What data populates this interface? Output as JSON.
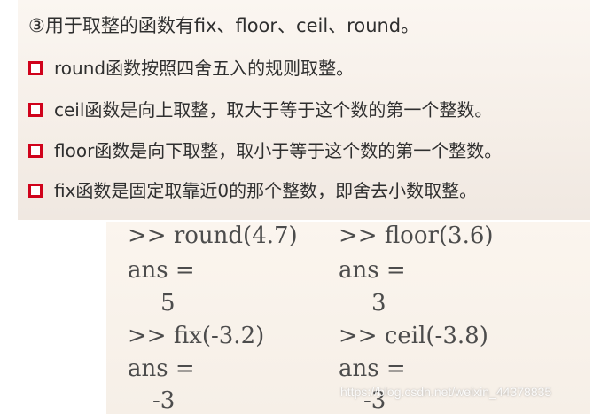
{
  "title": "③用于取整的函数有fix、floor、ceil、round。",
  "bullets": [
    "round函数按照四舍五入的规则取整。",
    "ceil函数是向上取整，取大于等于这个数的第一个整数。",
    "floor函数是向下取整，取小于等于这个数的第一个整数。",
    "fix函数是固定取靠近0的那个整数，即舍去小数取整。"
  ],
  "examples": {
    "round": {
      "cmd": ">> round(4.7)",
      "ans": "ans =",
      "val": "5"
    },
    "floor": {
      "cmd": ">> floor(3.6)",
      "ans": "ans =",
      "val": "3"
    },
    "fix": {
      "cmd": ">> fix(-3.2)",
      "ans": "ans =",
      "val": "-3"
    },
    "ceil": {
      "cmd": ">> ceil(-3.8)",
      "ans": "ans =",
      "val": "-3"
    }
  },
  "watermark": "https://blog.csdn.net/weixin_44378835",
  "colors": {
    "bullet_marker": "#d0021b",
    "text": "#2f2f2f",
    "code": "#4c4c4c"
  }
}
